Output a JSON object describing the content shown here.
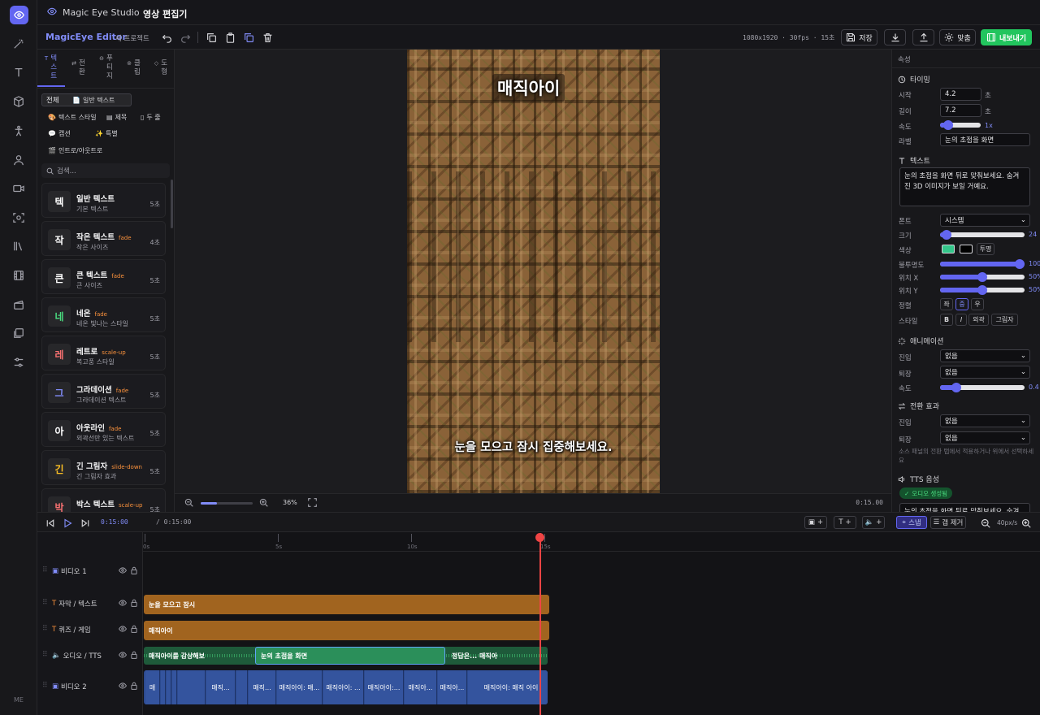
{
  "app": {
    "name": "Magic Eye Studio",
    "page": "영상 편집기",
    "footer": "ME"
  },
  "toolbar": {
    "editor_title": "MagicEye Editor",
    "project": "새 프로젝트",
    "meta": "1080x1920 · 30fps · 15초",
    "save": "저장",
    "fit": "맞춤",
    "export": "내보내기"
  },
  "left": {
    "tabs": [
      "텍스트",
      "전환",
      "푸티지",
      "클립",
      "도형"
    ],
    "chips": [
      "전체",
      "일반 텍스트",
      "텍스트 스타일",
      "제목",
      "두 줄",
      "캡션",
      "특별",
      "인트로/아웃트로"
    ],
    "search_placeholder": "검색...",
    "items": [
      {
        "thumb": "텍",
        "title": "일반 텍스트",
        "badge": "",
        "sub": "기본 텍스트",
        "dur": "5초",
        "color": "#ffffff"
      },
      {
        "thumb": "작",
        "title": "작은 텍스트",
        "badge": "fade",
        "sub": "작은 사이즈",
        "dur": "4초",
        "color": "#ffffff"
      },
      {
        "thumb": "큰",
        "title": "큰 텍스트",
        "badge": "fade",
        "sub": "큰 사이즈",
        "dur": "5초",
        "color": "#ffffff"
      },
      {
        "thumb": "네",
        "title": "네온",
        "badge": "fade",
        "sub": "네온 빛나는 스타일",
        "dur": "5초",
        "color": "#4ade80"
      },
      {
        "thumb": "레",
        "title": "레트로",
        "badge": "scale-up",
        "sub": "복고풍 스타일",
        "dur": "5초",
        "color": "#f87171"
      },
      {
        "thumb": "그",
        "title": "그라데이션",
        "badge": "fade",
        "sub": "그라데이션 텍스트",
        "dur": "5초",
        "color": "#818cf8"
      },
      {
        "thumb": "아",
        "title": "아웃라인",
        "badge": "fade",
        "sub": "외곽선만 있는 텍스트",
        "dur": "5초",
        "color": "#ffffff"
      },
      {
        "thumb": "긴",
        "title": "긴 그림자",
        "badge": "slide-down",
        "sub": "긴 그림자 효과",
        "dur": "5초",
        "color": "#fbbf24"
      },
      {
        "thumb": "박",
        "title": "박스 텍스트",
        "badge": "scale-up",
        "sub": "",
        "dur": "5초",
        "color": "#f87171"
      }
    ]
  },
  "canvas": {
    "title_overlay": "매직아이",
    "caption": "눈을 모으고 잠시 집중해보세요.",
    "zoom": "36%",
    "duration": "0:15.00"
  },
  "props": {
    "header": "속성",
    "timing_title": "타이밍",
    "start_label": "시작",
    "start_value": "4.2",
    "start_unit": "초",
    "length_label": "길이",
    "length_value": "7.2",
    "length_unit": "초",
    "speed_label": "속도",
    "speed_value": "1x",
    "label_label": "라벨",
    "label_value": "눈의 초점을 화면",
    "text_title": "텍스트",
    "text_value": "눈의 초점을 화면 뒤로 맞춰보세요. 숨겨진 3D 이미지가 보일 거예요.",
    "font_label": "폰트",
    "font_value": "시스템",
    "size_label": "크기",
    "size_value": "24",
    "color_label": "색상",
    "transparent": "투명",
    "opacity_label": "불투명도",
    "opacity_value": "100",
    "posx_label": "위치 X",
    "posx_value": "50%",
    "posy_label": "위치 Y",
    "posy_value": "50%",
    "align_label": "정렬",
    "align_opts": [
      "좌",
      "중",
      "우"
    ],
    "style_label": "스타일",
    "style_opts": [
      "B",
      "I",
      "외곽",
      "그림자"
    ],
    "anim_title": "애니메이션",
    "in_label": "진입",
    "in_value": "없음",
    "out_label": "퇴장",
    "out_value": "없음",
    "anim_speed_label": "속도",
    "anim_speed_value": "0.4",
    "trans_title": "전환 효과",
    "tin_label": "진입",
    "tin_value": "없음",
    "tout_label": "퇴장",
    "tout_value": "없음",
    "trans_hint": "소스 패널의 전환 탭에서 적용하거나 위에서 선택하세요",
    "tts_title": "TTS 음성",
    "tts_badge": "오디오 생성됨",
    "tts_text": "눈의 초점을 화면 뒤로 맞춰보세요. 숨겨"
  },
  "playback": {
    "current": "0:15:00",
    "total": "/ 0:15:00",
    "snap": "스냅",
    "gap": "갭 제거",
    "zoom": "40px/s"
  },
  "timeline": {
    "ruler": [
      "0s",
      "5s",
      "10s",
      "15s"
    ],
    "tracks": [
      "비디오 1",
      "자막 / 텍스트",
      "퀴즈 / 게임",
      "오디오 / TTS",
      "비디오 2"
    ],
    "subtitle_clip": "눈을 모으고 잠시",
    "quiz_clip": "매직아이",
    "audio_clips": [
      "매직아이를 감상해보",
      "눈의 초점을 화면",
      "정답은... 매직아",
      ""
    ],
    "video2_clips": [
      "매",
      "",
      "",
      "",
      "",
      "매직...",
      "",
      "매직...",
      "매직아이: 매...",
      "매직아이: ...",
      "매직아이:...",
      "매직아...",
      "매직아...",
      "매직아이: 매직 아이"
    ]
  },
  "colors": {
    "accent": "#6366f1",
    "export": "#22c55e",
    "playhead": "#ef4444",
    "clip_text": "#a1641f",
    "clip_audio": "#1e5a3a",
    "clip_video": "#2c4a8f"
  }
}
